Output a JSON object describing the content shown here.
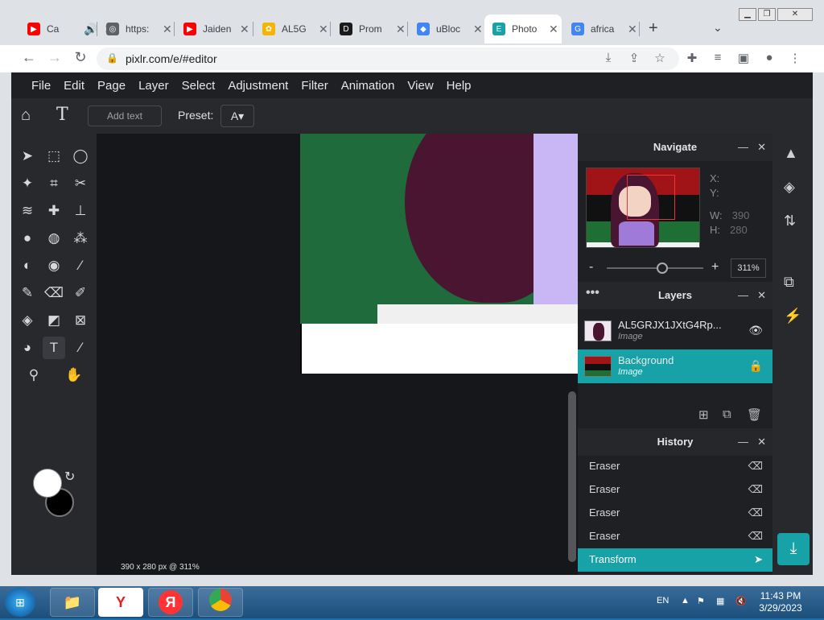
{
  "browser": {
    "tabs": [
      {
        "title": "Ca",
        "icon": "youtube-icon",
        "color": "#ff0000"
      },
      {
        "title": "https:",
        "icon": "globe-icon",
        "color": "#5f6368"
      },
      {
        "title": "Jaiden",
        "icon": "youtube-icon",
        "color": "#ff0000"
      },
      {
        "title": "AL5G",
        "icon": "google-photos-icon",
        "color": "#f4b400"
      },
      {
        "title": "Prom",
        "icon": "disney-icon",
        "color": "#1a1a1a"
      },
      {
        "title": "uBloc",
        "icon": "chrome-webstore-icon",
        "color": "#4285f4"
      },
      {
        "title": "Photo",
        "icon": "pixlr-icon",
        "color": "#16a2a6"
      },
      {
        "title": "africa",
        "icon": "google-icon",
        "color": "#4285f4"
      }
    ],
    "url": "pixlr.com/e/#editor"
  },
  "app": {
    "menu": [
      "File",
      "Edit",
      "Page",
      "Layer",
      "Select",
      "Adjustment",
      "Filter",
      "Animation",
      "View",
      "Help"
    ],
    "options": {
      "add_text_placeholder": "Add text",
      "preset_label": "Preset:"
    },
    "status": "390 x 280 px @ 311%",
    "navigate": {
      "title": "Navigate",
      "x_label": "X:",
      "y_label": "Y:",
      "w_label": "W:",
      "w_value": "390",
      "h_label": "H:",
      "h_value": "280",
      "zoom": "311%"
    },
    "layers": {
      "title": "Layers",
      "items": [
        {
          "name": "AL5GRJX1JXtG4Rp...",
          "type": "Image"
        },
        {
          "name": "Background",
          "type": "Image"
        }
      ]
    },
    "history": {
      "title": "History",
      "items": [
        "Eraser",
        "Eraser",
        "Eraser",
        "Eraser",
        "Transform"
      ]
    }
  },
  "taskbar": {
    "language": "EN",
    "time": "11:43 PM",
    "date": "3/29/2023"
  },
  "colors": {
    "accent": "#16a2a6"
  }
}
